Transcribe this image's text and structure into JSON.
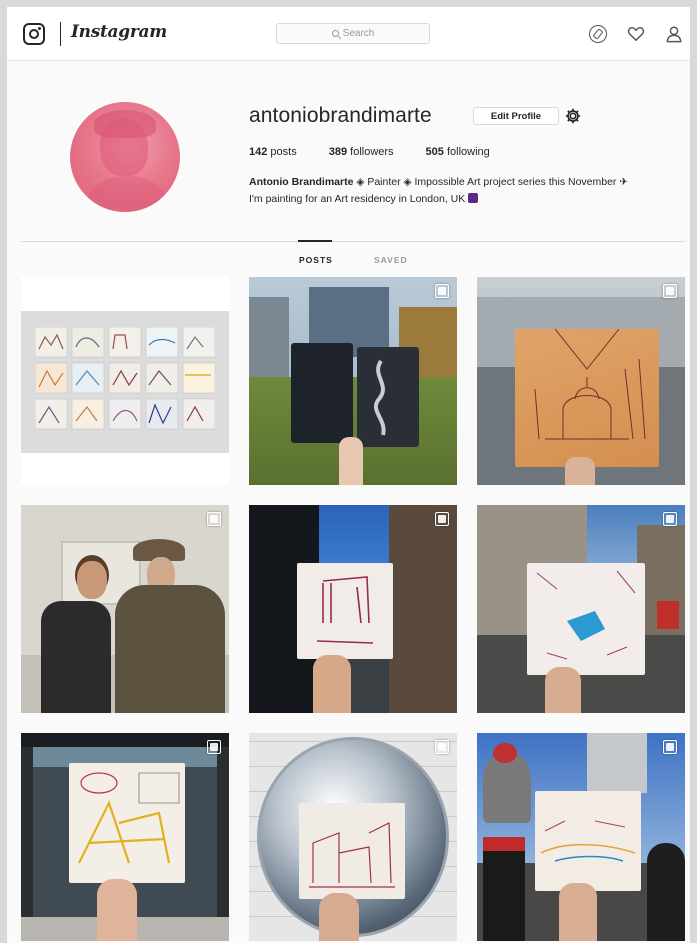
{
  "header": {
    "logo_text": "Instagram",
    "search_placeholder": "Search"
  },
  "profile": {
    "username": "antoniobrandimarte",
    "edit_label": "Edit Profile",
    "stats": {
      "posts_count": "142",
      "posts_label": "posts",
      "followers_count": "389",
      "followers_label": "followers",
      "following_count": "505",
      "following_label": "following"
    },
    "bio_name": "Antonio Brandimarte",
    "bio_line1": " ◈ Painter ◈ Impossible Art project series this November ✈",
    "bio_line2": "I'm painting for an Art residency in London, UK"
  },
  "tabs": [
    {
      "label": "POSTS",
      "active": true
    },
    {
      "label": "SAVED",
      "active": false
    }
  ],
  "posts": [
    {
      "name": "post-grid-of-paintings",
      "multi": false
    },
    {
      "name": "post-sketchbook-park",
      "multi": true
    },
    {
      "name": "post-st-pauls-drawing",
      "multi": true
    },
    {
      "name": "post-two-men-gallery",
      "multi": true
    },
    {
      "name": "post-drawing-street-blue-sky",
      "multi": true
    },
    {
      "name": "post-blue-drawing-street",
      "multi": true
    },
    {
      "name": "post-yellow-drawing-window",
      "multi": true
    },
    {
      "name": "post-drawing-convex-mirror",
      "multi": true
    },
    {
      "name": "post-drawing-dragon-statue",
      "multi": true
    }
  ]
}
